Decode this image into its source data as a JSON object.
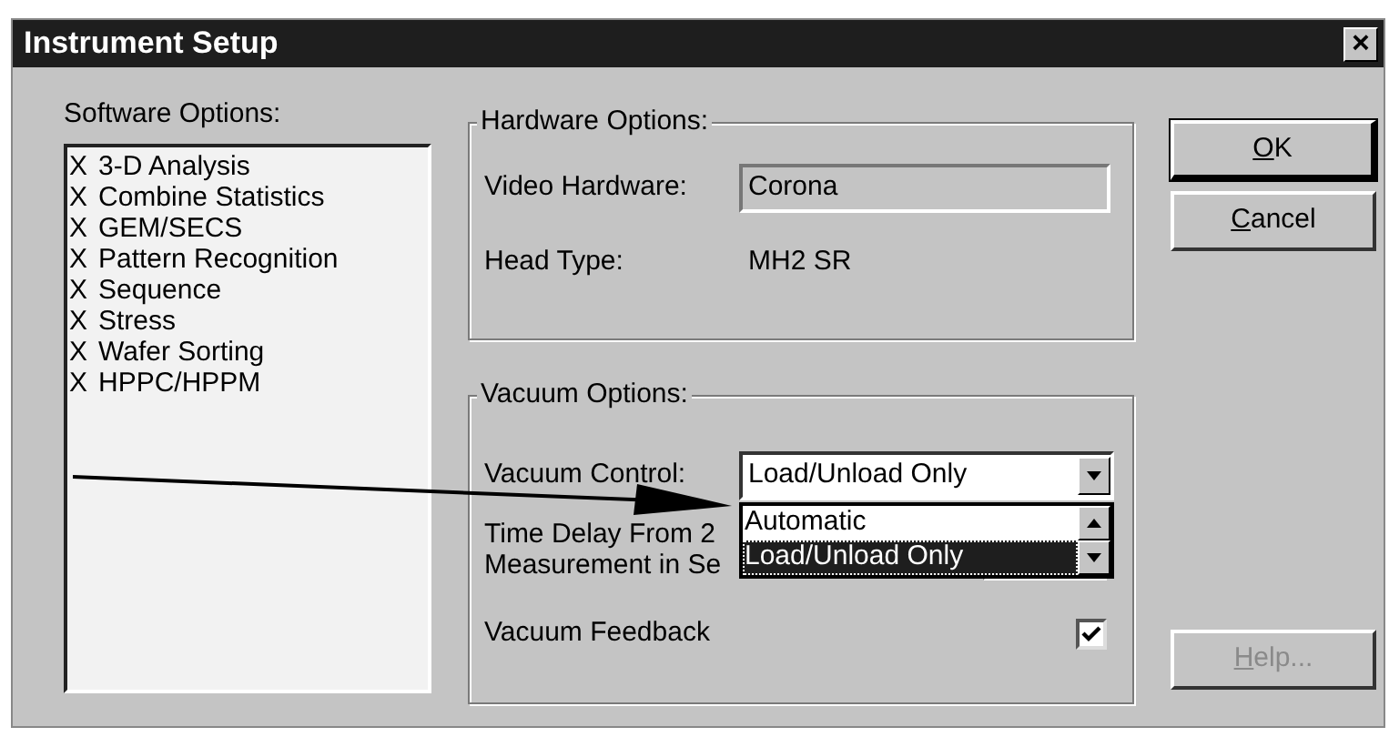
{
  "window": {
    "title": "Instrument Setup",
    "close": "×"
  },
  "software_options": {
    "label": "Software Options:",
    "items": [
      {
        "mark": "X",
        "label": "3-D Analysis"
      },
      {
        "mark": "X",
        "label": "Combine Statistics"
      },
      {
        "mark": "X",
        "label": "GEM/SECS"
      },
      {
        "mark": "X",
        "label": "Pattern Recognition"
      },
      {
        "mark": "X",
        "label": "Sequence"
      },
      {
        "mark": "X",
        "label": "Stress"
      },
      {
        "mark": "X",
        "label": "Wafer Sorting"
      },
      {
        "mark": "X",
        "label": "HPPC/HPPM"
      }
    ]
  },
  "hardware_options": {
    "label": "Hardware Options:",
    "video_hardware_label": "Video Hardware:",
    "video_hardware_value": "Corona",
    "head_type_label": "Head Type:",
    "head_type_value": "MH2 SR"
  },
  "vacuum_options": {
    "label": "Vacuum Options:",
    "vacuum_control_label": "Vacuum Control:",
    "vacuum_control_value": "Load/Unload Only",
    "dropdown_open": true,
    "dropdown_items": [
      {
        "label": "Automatic",
        "selected": false
      },
      {
        "label": "Load/Unload Only",
        "selected": true
      }
    ],
    "time_delay_label_line1": "Time Delay From 2",
    "time_delay_label_line2": "Measurement in Se",
    "vacuum_feedback_label": "Vacuum Feedback",
    "vacuum_feedback_checked": true
  },
  "buttons": [
    {
      "label": "OK",
      "default": true,
      "disabled": false,
      "underline_first": true
    },
    {
      "label": "Cancel",
      "default": false,
      "disabled": false,
      "underline_first": true
    },
    {
      "label": "Help...",
      "default": false,
      "disabled": true,
      "underline_first": true
    }
  ]
}
